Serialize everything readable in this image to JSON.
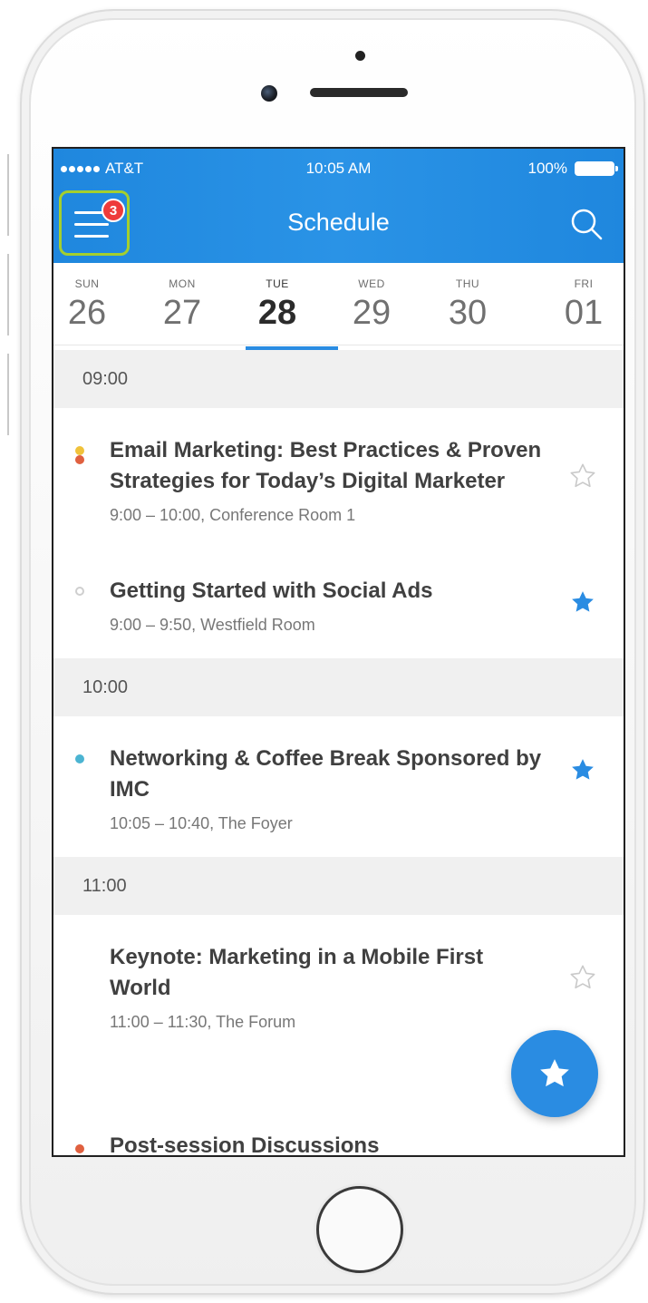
{
  "status_bar": {
    "carrier": "AT&T",
    "time": "10:05 AM",
    "battery": "100%"
  },
  "nav": {
    "title": "Schedule",
    "menu_badge": "3"
  },
  "days": [
    {
      "name": "SUN",
      "num": "26",
      "selected": false
    },
    {
      "name": "MON",
      "num": "27",
      "selected": false
    },
    {
      "name": "TUE",
      "num": "28",
      "selected": true
    },
    {
      "name": "WED",
      "num": "29",
      "selected": false
    },
    {
      "name": "THU",
      "num": "30",
      "selected": false
    },
    {
      "name": "FRI",
      "num": "01",
      "selected": false
    }
  ],
  "sections": [
    {
      "time": "09:00",
      "sessions": [
        {
          "title": "Email Marketing: Best Practices & Proven Strategies for Today’s Digital Marketer",
          "meta": "9:00 – 10:00,  Conference Room 1",
          "starred": false
        },
        {
          "title": "Getting Started with Social Ads",
          "meta": "9:00 – 9:50,  Westfield Room",
          "starred": true
        }
      ]
    },
    {
      "time": "10:00",
      "sessions": [
        {
          "title": "Networking & Coffee Break Sponsored by IMC",
          "meta": "10:05 – 10:40,  The Foyer",
          "starred": true
        }
      ]
    },
    {
      "time": "11:00",
      "sessions": [
        {
          "title": "Keynote: Marketing in a Mobile First World",
          "meta": "11:00 – 11:30,  The Forum",
          "starred": false
        }
      ]
    }
  ],
  "partial_session": {
    "title": "Post-session Discussions"
  },
  "colors": {
    "header_blue": "#1f87de",
    "accent_blue": "#2a8ce2",
    "badge_red": "#ee3b3b",
    "highlight_green": "#a4cf2e",
    "track_yellow": "#f0c23a",
    "track_orange": "#e0603f",
    "track_teal": "#4bb4d2"
  },
  "icons": {
    "menu": "hamburger-icon",
    "search": "search-icon",
    "star_filled": "star-filled-icon",
    "star_outline": "star-outline-icon",
    "fab": "star-icon"
  }
}
